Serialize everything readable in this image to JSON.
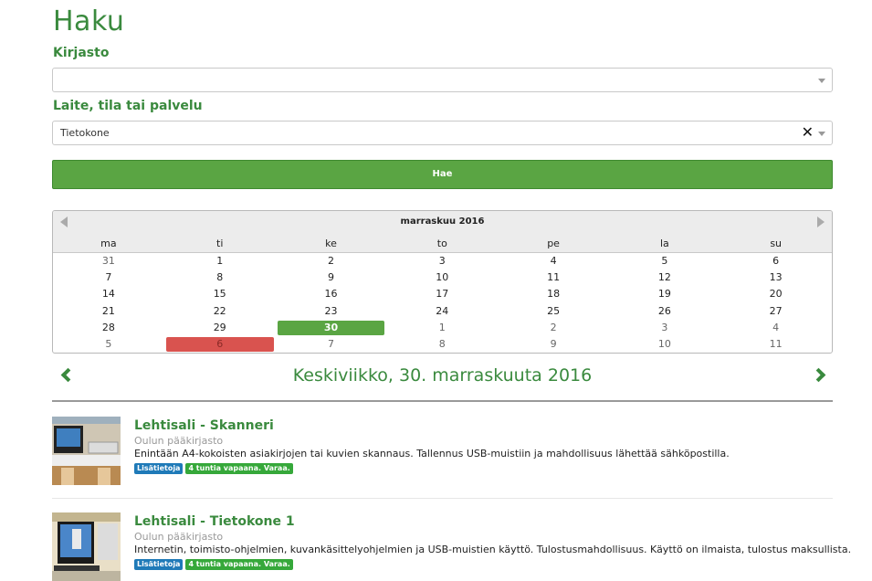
{
  "page": {
    "title": "Haku"
  },
  "form": {
    "library_label": "Kirjasto",
    "library_value": "",
    "resource_label": "Laite, tila tai palvelu",
    "resource_value": "Tietokone",
    "search_button": "Hae"
  },
  "calendar": {
    "month": "marraskuu 2016",
    "weekdays": [
      "ma",
      "ti",
      "ke",
      "to",
      "pe",
      "la",
      "su"
    ],
    "weeks": [
      [
        "31",
        "1",
        "2",
        "3",
        "4",
        "5",
        "6"
      ],
      [
        "7",
        "8",
        "9",
        "10",
        "11",
        "12",
        "13"
      ],
      [
        "14",
        "15",
        "16",
        "17",
        "18",
        "19",
        "20"
      ],
      [
        "21",
        "22",
        "23",
        "24",
        "25",
        "26",
        "27"
      ],
      [
        "28",
        "29",
        "30",
        "1",
        "2",
        "3",
        "4"
      ],
      [
        "5",
        "6",
        "7",
        "8",
        "9",
        "10",
        "11"
      ]
    ],
    "selected_color": "#5aa543",
    "unavailable_color": "#d9534f"
  },
  "day_nav": {
    "date": "Keskiviikko, 30. marraskuuta 2016"
  },
  "results": [
    {
      "name": "Lehtisali - Skanneri",
      "library": "Oulun pääkirjasto",
      "description": "Enintään A4-kokoisten asiakirjojen tai kuvien skannaus. Tallennus USB-muistiin ja mahdollisuus lähettää sähköpostilla.",
      "info_badge": "Lisätietoja",
      "availability_badge": "4 tuntia vapaana. Varaa."
    },
    {
      "name": "Lehtisali - Tietokone 1",
      "library": "Oulun pääkirjasto",
      "description": "Internetin, toimisto-ohjelmien, kuvankäsittelyohjelmien ja USB-muistien käyttö. Tulostusmahdollisuus. Käyttö on ilmaista, tulostus maksullista.",
      "info_badge": "Lisätietoja",
      "availability_badge": "4 tuntia vapaana. Varaa."
    }
  ]
}
